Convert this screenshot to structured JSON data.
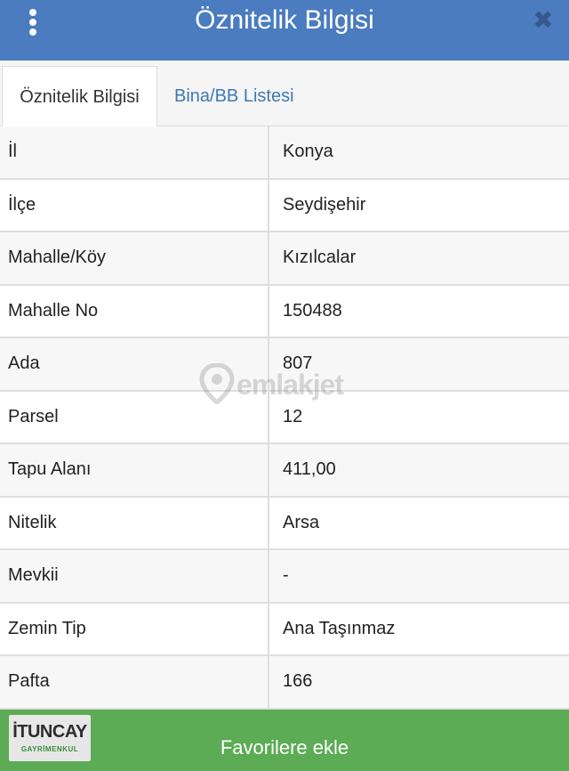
{
  "header": {
    "title": "Öznitelik Bilgisi",
    "menu_icon": "vertical-dots-icon",
    "close_icon": "close-icon",
    "close_glyph": "✖"
  },
  "tabs": [
    {
      "label": "Öznitelik Bilgisi",
      "active": true
    },
    {
      "label": "Bina/BB Listesi",
      "active": false
    }
  ],
  "attributes": [
    {
      "key": "İl",
      "value": "Konya"
    },
    {
      "key": "İlçe",
      "value": "Seydişehir"
    },
    {
      "key": "Mahalle/Köy",
      "value": "Kızılcalar"
    },
    {
      "key": "Mahalle No",
      "value": "150488"
    },
    {
      "key": "Ada",
      "value": "807"
    },
    {
      "key": "Parsel",
      "value": "12"
    },
    {
      "key": "Tapu Alanı",
      "value": "411,00"
    },
    {
      "key": "Nitelik",
      "value": "Arsa"
    },
    {
      "key": "Mevkii",
      "value": "-"
    },
    {
      "key": "Zemin Tip",
      "value": "Ana Taşınmaz"
    },
    {
      "key": "Pafta",
      "value": "166"
    }
  ],
  "watermark": {
    "text": "emlakjet",
    "icon": "location-pin-icon"
  },
  "footer": {
    "button_label": "Favorilere ekle",
    "logo": {
      "main": "İTUNCAY",
      "sub": "GAYRİMENKUL"
    }
  },
  "colors": {
    "header_bg": "#4a7cbf",
    "tab_link": "#3f78b5",
    "footer_bg": "#5cab55"
  }
}
